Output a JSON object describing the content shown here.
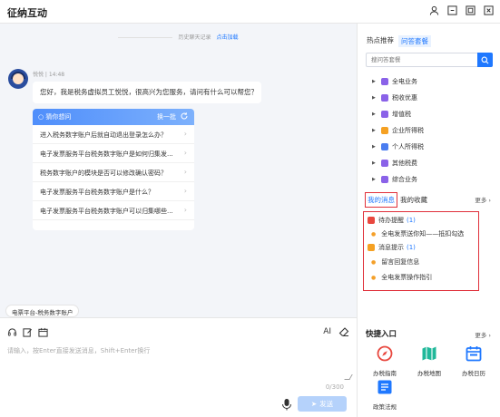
{
  "window": {
    "title": "征纳互动"
  },
  "chat": {
    "history_label": "历史聊天记录",
    "history_link": "点击加载",
    "sender": "悦悦 | 14:48",
    "greeting": "您好，我是税务虚拟员工悦悦，很高兴为您服务，请问有什么可以帮您？",
    "guess_title": "猜你想问",
    "swap_label": "换一批",
    "questions": [
      "进入税务数字账户后就自动退出登录怎么办？",
      "电子发票服务平台税务数字账户是如何归集发...",
      "税务数字账户的模块是否可以修改确认密码？",
      "电子发票服务平台税务数字账户是什么？",
      "电子发票服务平台税务数字账户可以归集哪些..."
    ],
    "scene_tag": "电票平台-税务数字账户"
  },
  "input": {
    "placeholder": "请输入，按Enter直接发送消息，Shift+Enter换行",
    "counter": "0/300",
    "send_label": "发送",
    "ai_label": "AI"
  },
  "right": {
    "tab_hot": "热点推荐",
    "tab_qa": "问答套餐",
    "search_placeholder": "搜问答套餐",
    "categories": [
      {
        "label": "全电业务",
        "color": "#8a62e8"
      },
      {
        "label": "税收优惠",
        "color": "#8a62e8"
      },
      {
        "label": "增值税",
        "color": "#8a62e8"
      },
      {
        "label": "企业所得税",
        "color": "#f5a123"
      },
      {
        "label": "个人所得税",
        "color": "#4a7df0"
      },
      {
        "label": "其他税费",
        "color": "#8a62e8"
      },
      {
        "label": "综合业务",
        "color": "#8a62e8"
      }
    ],
    "tab_messages": "我的消息",
    "tab_favorites": "我的收藏",
    "more": "更多",
    "messages": {
      "todo_label": "待办提醒",
      "todo_count": "(1)",
      "todo_items": [
        "全电发票送你知——抵扣勾选"
      ],
      "notice_label": "消息提示",
      "notice_count": "(1)",
      "notice_items": [
        "留言回复信息",
        "全电发票操作指引"
      ]
    },
    "quick_title": "快捷入口",
    "quick_more": "更多",
    "quick": [
      "办税指南",
      "办税地图",
      "办税日历",
      "政策法规"
    ]
  }
}
